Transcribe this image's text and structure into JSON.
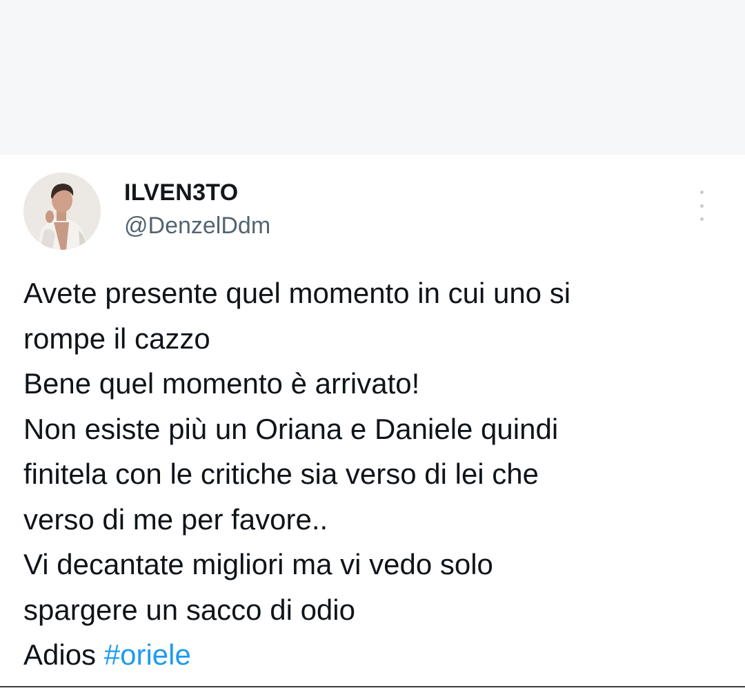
{
  "tweet": {
    "display_name": "ILVEN3TO",
    "handle": "@DenzelDdm",
    "avatar_icon": "profile-photo",
    "more_icon": "more-options-icon",
    "body_lines": [
      "Avete presente quel momento in cui uno si",
      "rompe il cazzo",
      "Bene quel momento è arrivato!",
      "Non esiste più un Oriana e Daniele quindi",
      "finitela con le critiche sia verso di lei che",
      "verso di me per favore..",
      "Vi decantate migliori ma vi vedo solo",
      "spargere un sacco di odio"
    ],
    "last_line_text": "Adios ",
    "hashtag": "#oriele"
  },
  "colors": {
    "background_top": "#f6f7f9",
    "card": "#ffffff",
    "text": "#0f1419",
    "secondary_text": "#536471",
    "link": "#1d9bf0"
  }
}
